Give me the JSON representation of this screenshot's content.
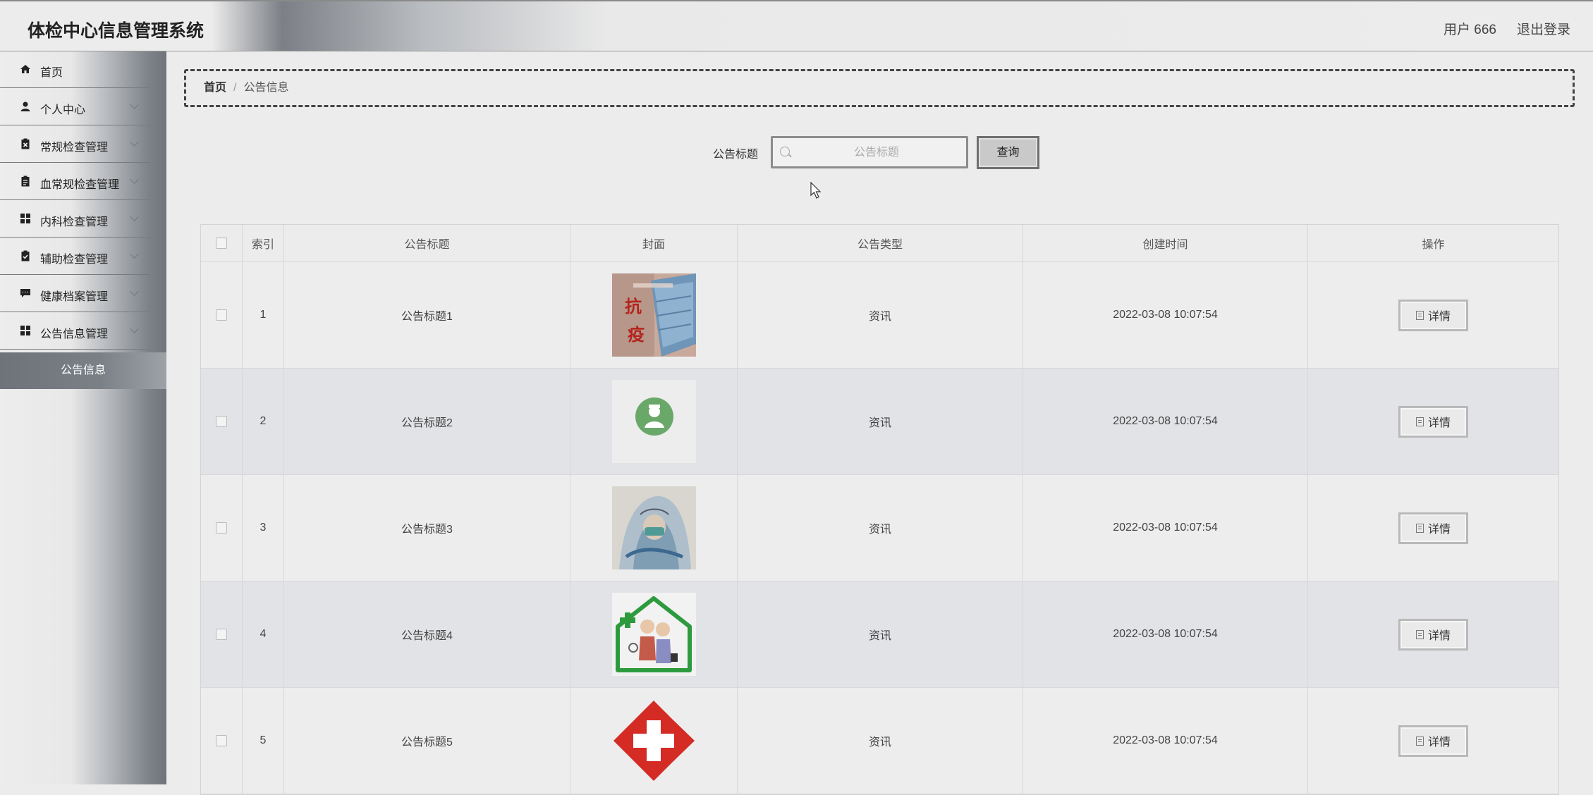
{
  "header": {
    "title": "体检中心信息管理系统",
    "user": "用户 666",
    "logout": "退出登录"
  },
  "sidebar": {
    "items": [
      {
        "label": "首页",
        "icon": "home-icon",
        "arrow": false
      },
      {
        "label": "个人中心",
        "icon": "user-icon",
        "arrow": true
      },
      {
        "label": "常规检查管理",
        "icon": "clipboard-x-icon",
        "arrow": true
      },
      {
        "label": "血常规检查管理",
        "icon": "clipboard-icon",
        "arrow": true
      },
      {
        "label": "内科检查管理",
        "icon": "grid-icon",
        "arrow": true
      },
      {
        "label": "辅助检查管理",
        "icon": "clipboard-check-icon",
        "arrow": true
      },
      {
        "label": "健康档案管理",
        "icon": "chat-icon",
        "arrow": true
      },
      {
        "label": "公告信息管理",
        "icon": "grid-icon",
        "arrow": true
      }
    ],
    "active_sub": "公告信息"
  },
  "breadcrumb": {
    "home": "首页",
    "separator": "/",
    "current": "公告信息"
  },
  "search": {
    "label": "公告标题",
    "placeholder": "公告标题",
    "button": "查询"
  },
  "table": {
    "columns": [
      "索引",
      "公告标题",
      "封面",
      "公告类型",
      "创建时间",
      "操作"
    ],
    "rows": [
      {
        "index": "1",
        "title": "公告标题1",
        "cover": "mask-photo",
        "type": "资讯",
        "time": "2022-03-08 10:07:54",
        "action": "详情"
      },
      {
        "index": "2",
        "title": "公告标题2",
        "cover": "doctor-avatar",
        "type": "资讯",
        "time": "2022-03-08 10:07:54",
        "action": "详情"
      },
      {
        "index": "3",
        "title": "公告标题3",
        "cover": "medic-painting",
        "type": "资讯",
        "time": "2022-03-08 10:07:54",
        "action": "详情"
      },
      {
        "index": "4",
        "title": "公告标题4",
        "cover": "elderly-care-house",
        "type": "资讯",
        "time": "2022-03-08 10:07:54",
        "action": "详情"
      },
      {
        "index": "5",
        "title": "公告标题5",
        "cover": "red-cross",
        "type": "资讯",
        "time": "2022-03-08 10:07:54",
        "action": "详情"
      }
    ]
  },
  "colors": {
    "accent": "#7b8087",
    "header_gradient_dark": "#7c8086",
    "cross_red": "#d42b25",
    "house_green": "#2e9a3e"
  }
}
